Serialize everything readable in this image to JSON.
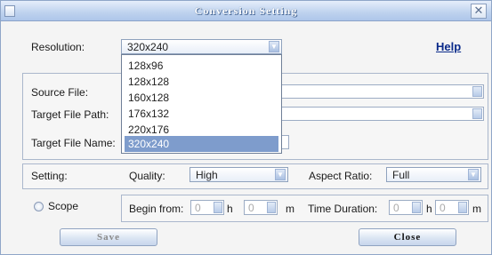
{
  "window": {
    "title": "Conversion Setting",
    "close_symbol": "✕"
  },
  "resolution": {
    "label": "Resolution:",
    "selected": "320x240",
    "options": [
      "128x96",
      "128x128",
      "160x128",
      "176x132",
      "220x176",
      "320x240"
    ],
    "highlighted_index": 5
  },
  "help_label": "Help",
  "files": {
    "source_label": "Source File:",
    "target_path_label": "Target File Path:",
    "target_name_label": "Target File Name:"
  },
  "setting": {
    "label": "Setting:",
    "quality_label": "Quality:",
    "quality_value": "High",
    "aspect_label": "Aspect Ratio:",
    "aspect_value": "Full"
  },
  "scope": {
    "label": "Scope",
    "begin_label": "Begin from:",
    "begin_hours": "0",
    "h_unit": "h",
    "begin_minutes": "0",
    "m_unit": "m",
    "duration_label": "Time Duration:",
    "duration_hours": "0",
    "duration_minutes": "0"
  },
  "buttons": {
    "save": "Save",
    "close": "Close"
  },
  "colors": {
    "title_bar": "#bed2ee",
    "selection": "#7e9ccc",
    "help_link": "#0a2a8a"
  }
}
